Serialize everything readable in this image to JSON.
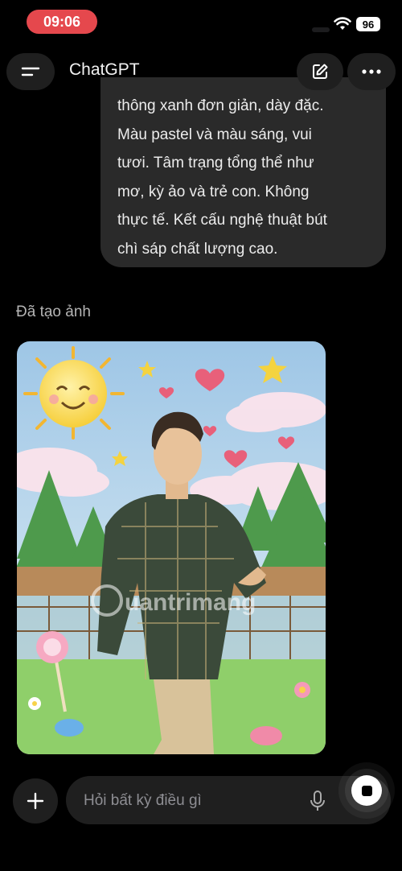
{
  "status_bar": {
    "time": "09:06",
    "battery": "96"
  },
  "header": {
    "title": "ChatGPT"
  },
  "message": {
    "lines": [
      "thông xanh đơn giản, dày đặc.",
      "Màu pastel và màu sáng, vui",
      "tươi. Tâm trạng tổng thể như",
      "mơ, kỳ ảo và trẻ con. Không",
      "thực tế. Kết cấu nghệ thuật bút",
      "chì sáp chất lượng cao."
    ]
  },
  "generated": {
    "label": "Đã tạo ảnh",
    "watermark": "Quantrimang"
  },
  "composer": {
    "placeholder": "Hỏi bất kỳ điều gì"
  },
  "colors": {
    "accent_time": "#e5484d",
    "bubble": "#2a2a2a",
    "control": "#1f1f1f"
  }
}
